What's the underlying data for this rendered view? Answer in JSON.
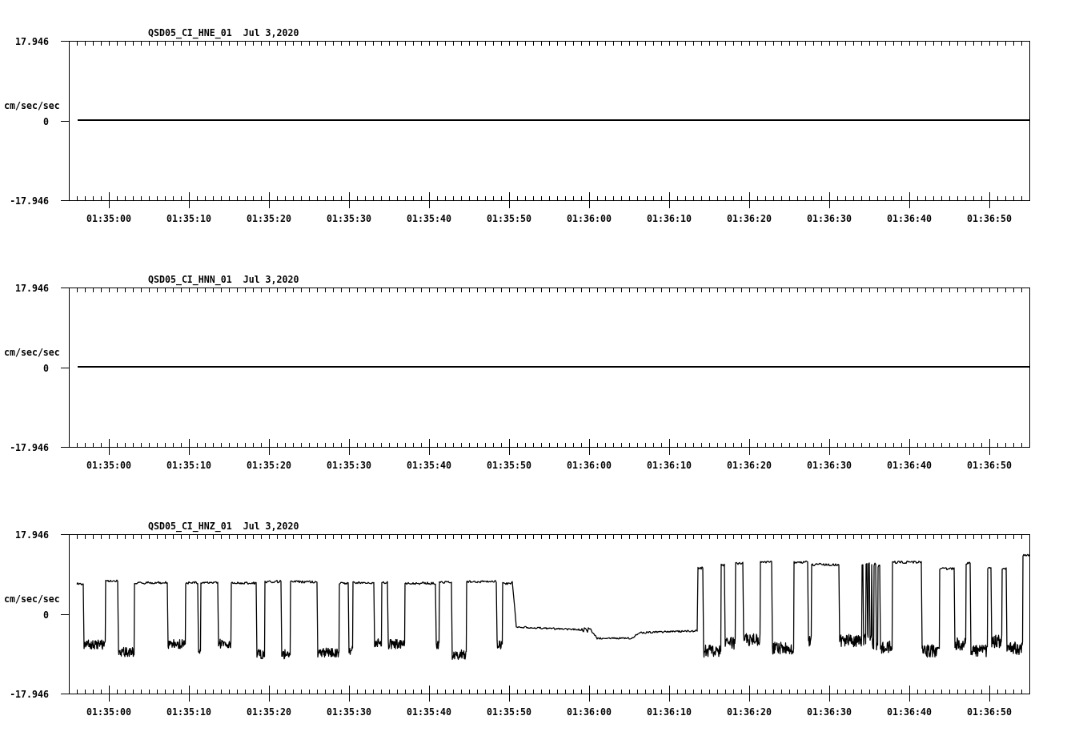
{
  "panels": [
    {
      "kind": "flat",
      "channel": "QSD05_CI_HNE_01",
      "date": "Jul 3,2020",
      "y_unit": "cm/sec/sec",
      "y_ticks": [
        "17.946",
        "0",
        "-17.946"
      ],
      "x_ticks": [
        "01:35:00",
        "01:35:10",
        "01:35:20",
        "01:35:30",
        "01:35:40",
        "01:35:50",
        "01:36:00",
        "01:36:10",
        "01:36:20",
        "01:36:30",
        "01:36:40",
        "01:36:50"
      ]
    },
    {
      "kind": "flat",
      "channel": "QSD05_CI_HNN_01",
      "date": "Jul 3,2020",
      "y_unit": "cm/sec/sec",
      "y_ticks": [
        "17.946",
        "0",
        "-17.946"
      ],
      "x_ticks": [
        "01:35:00",
        "01:35:10",
        "01:35:20",
        "01:35:30",
        "01:35:40",
        "01:35:50",
        "01:36:00",
        "01:36:10",
        "01:36:20",
        "01:36:30",
        "01:36:40",
        "01:36:50"
      ]
    },
    {
      "kind": "waveform",
      "channel": "QSD05_CI_HNZ_01",
      "date": "Jul 3,2020",
      "y_unit": "cm/sec/sec",
      "y_ticks": [
        "17.946",
        "0",
        "-17.946"
      ],
      "x_ticks": [
        "01:35:00",
        "01:35:10",
        "01:35:20",
        "01:35:30",
        "01:35:40",
        "01:35:50",
        "01:36:00",
        "01:36:10",
        "01:36:20",
        "01:36:30",
        "01:36:40",
        "01:36:50"
      ]
    }
  ]
}
